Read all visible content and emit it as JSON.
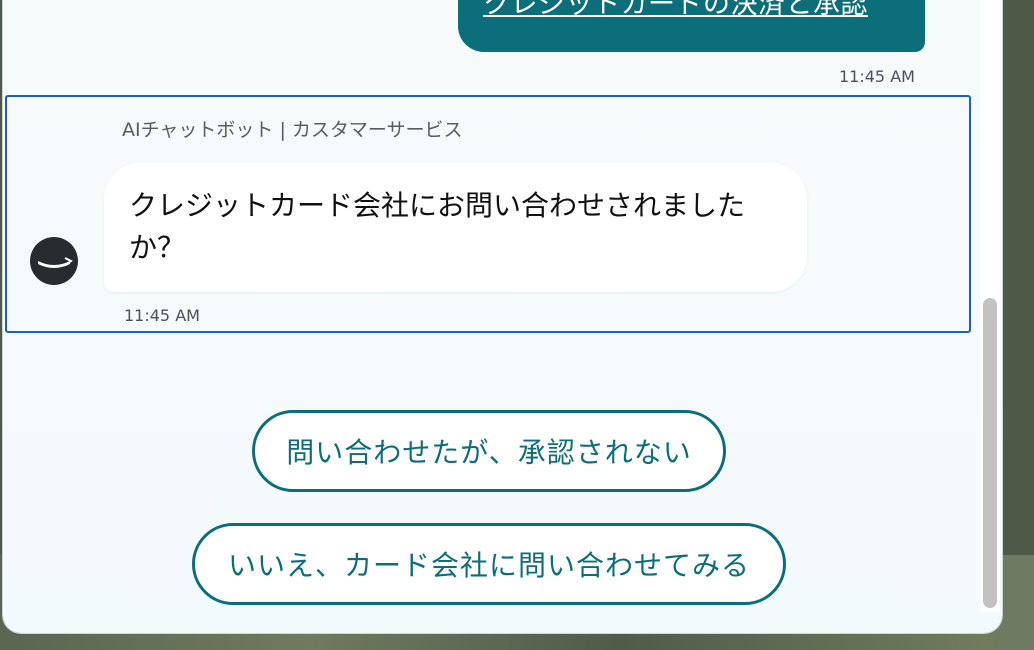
{
  "conversation": {
    "user_message": {
      "text": "クレジットカードの決済と承認",
      "time": "11:45 AM"
    },
    "bot_message": {
      "sender": "AIチャットボット | カスタマーサービス",
      "text": "クレジットカード会社にお問い合わせされましたか？",
      "time": "11:45 AM",
      "avatar_icon": "smile-logo-icon"
    }
  },
  "quick_replies": [
    {
      "label": "問い合わせたが、承認されない"
    },
    {
      "label": "いいえ、カード会社に問い合わせてみる"
    }
  ],
  "colors": {
    "accent": "#0b6e78",
    "focus_border": "#1b5fc4",
    "avatar_bg": "#262b2e"
  }
}
